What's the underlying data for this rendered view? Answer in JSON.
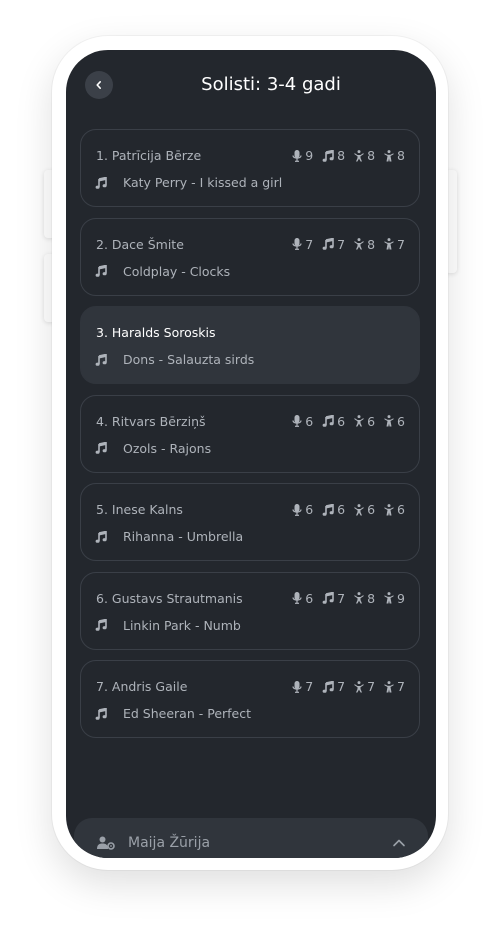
{
  "header": {
    "title": "Solisti: 3-4 gadi"
  },
  "contestants": [
    {
      "name": "1. Patrīcija Bērze",
      "song": "Katy Perry - I kissed a girl",
      "scores": [
        "9",
        "8",
        "8",
        "8"
      ],
      "active": false
    },
    {
      "name": "2. Dace Šmite",
      "song": "Coldplay - Clocks",
      "scores": [
        "7",
        "7",
        "8",
        "7"
      ],
      "active": false
    },
    {
      "name": "3. Haralds Soroskis",
      "song": "Dons - Salauzta sirds",
      "scores": [],
      "active": true
    },
    {
      "name": "4. Ritvars Bērziņš",
      "song": "Ozols - Rajons",
      "scores": [
        "6",
        "6",
        "6",
        "6"
      ],
      "active": false
    },
    {
      "name": "5. Inese Kalns",
      "song": "Rihanna - Umbrella",
      "scores": [
        "6",
        "6",
        "6",
        "6"
      ],
      "active": false
    },
    {
      "name": "6. Gustavs Strautmanis",
      "song": "Linkin Park - Numb",
      "scores": [
        "6",
        "7",
        "8",
        "9"
      ],
      "active": false
    },
    {
      "name": "7. Andris Gaile",
      "song": "Ed Sheeran - Perfect",
      "scores": [
        "7",
        "7",
        "7",
        "7"
      ],
      "active": false
    }
  ],
  "score_icons": [
    "microphone-icon",
    "music-note-icon",
    "dancer-icon",
    "costume-icon"
  ],
  "footer": {
    "judge_label": "Maija Žūrija"
  },
  "colors": {
    "background": "#23272d",
    "card_active": "#30353c",
    "text": "#aeb3ba",
    "accent": "#ffffff"
  }
}
